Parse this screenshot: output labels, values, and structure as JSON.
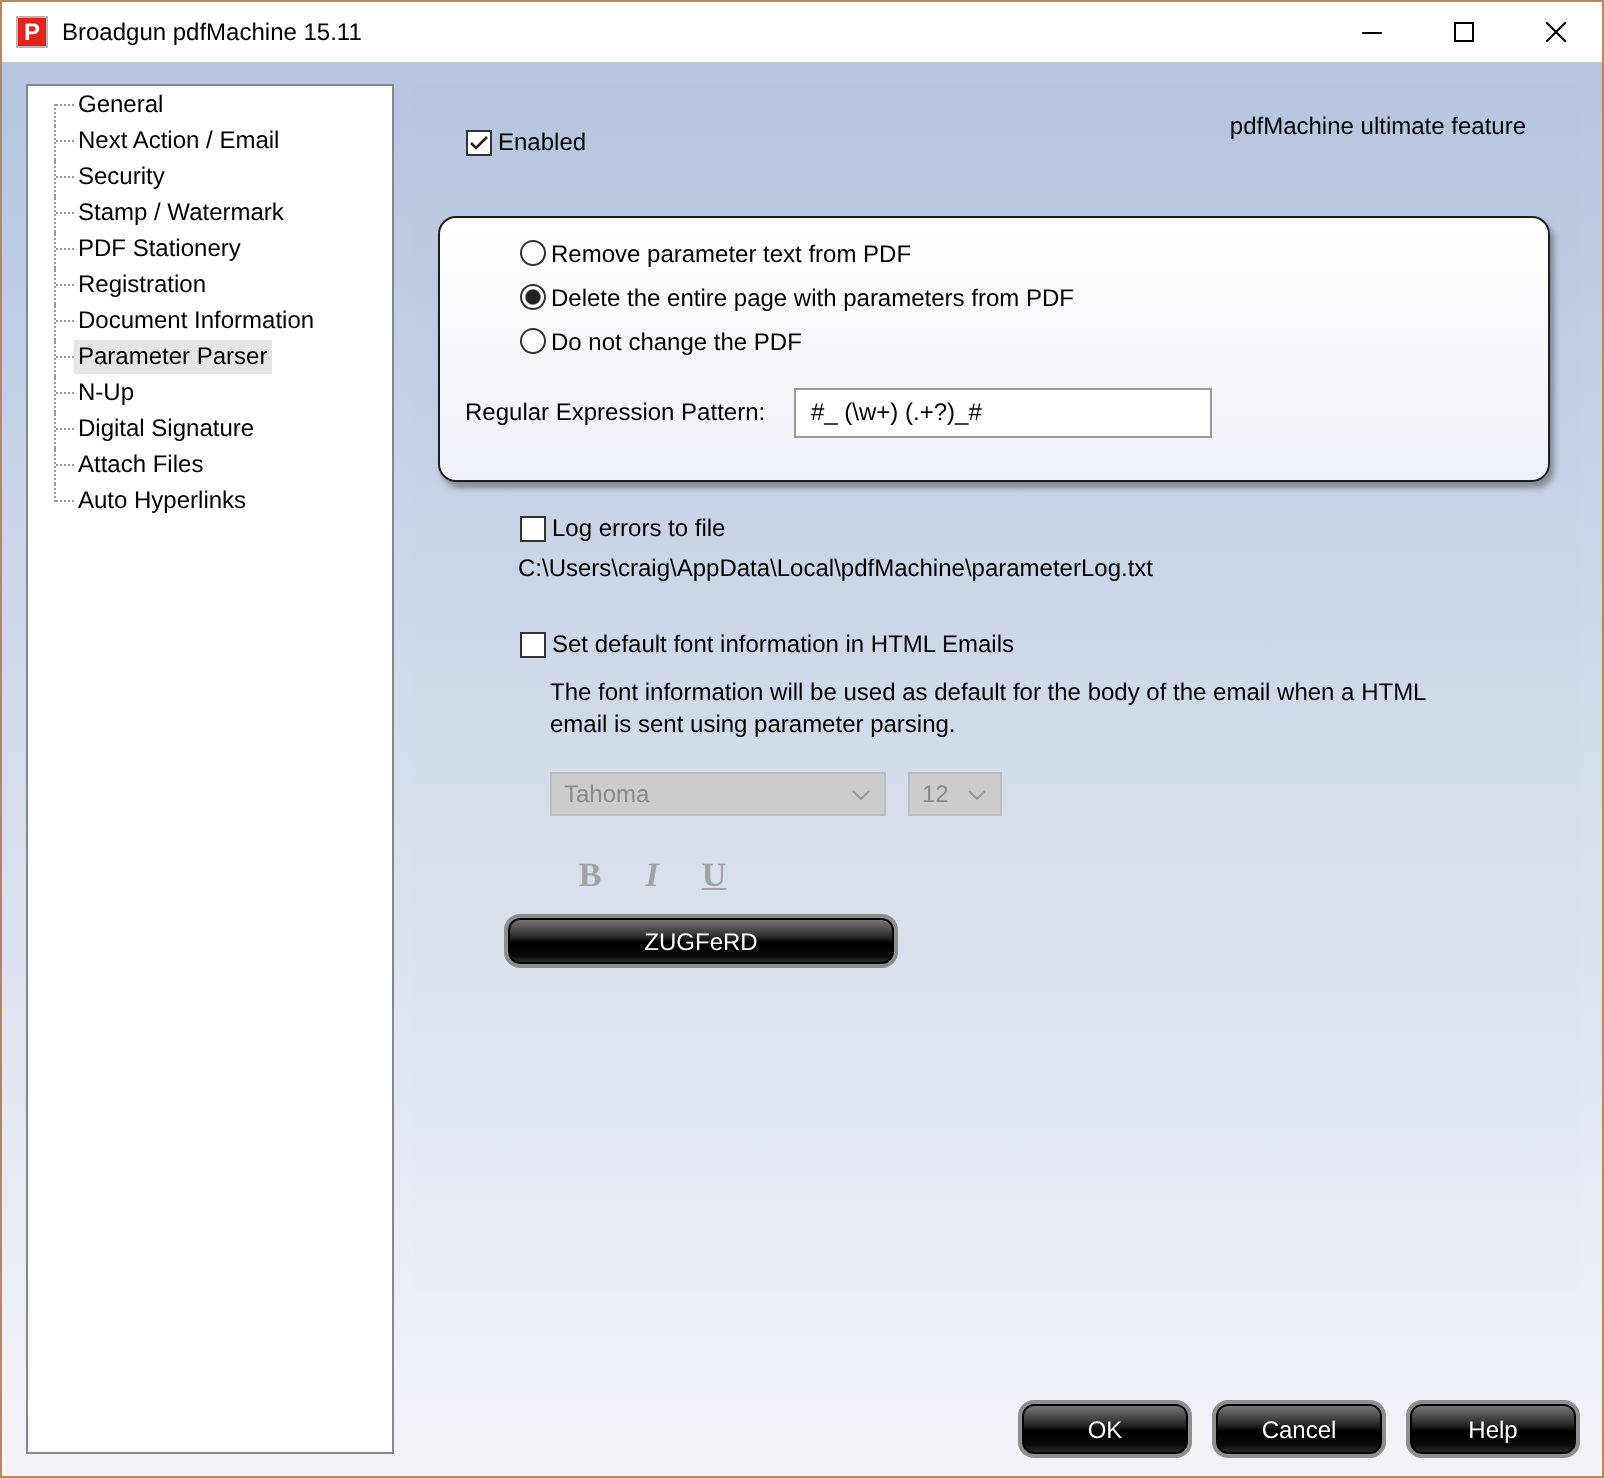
{
  "window": {
    "logo": "P",
    "title": "Broadgun pdfMachine 15.11"
  },
  "sidebar": {
    "items": [
      {
        "label": "General",
        "selected": false
      },
      {
        "label": "Next Action / Email",
        "selected": false
      },
      {
        "label": "Security",
        "selected": false
      },
      {
        "label": "Stamp / Watermark",
        "selected": false
      },
      {
        "label": "PDF Stationery",
        "selected": false
      },
      {
        "label": "Registration",
        "selected": false
      },
      {
        "label": "Document Information",
        "selected": false
      },
      {
        "label": "Parameter Parser",
        "selected": true
      },
      {
        "label": "N-Up",
        "selected": false
      },
      {
        "label": "Digital Signature",
        "selected": false
      },
      {
        "label": "Attach Files",
        "selected": false
      },
      {
        "label": "Auto Hyperlinks",
        "selected": false
      }
    ]
  },
  "panel": {
    "enabled": {
      "label": "Enabled",
      "checked": true
    },
    "feature_note": "pdfMachine ultimate feature",
    "page_action": {
      "options": [
        {
          "label": "Remove parameter text from PDF",
          "selected": false
        },
        {
          "label": "Delete the entire page with parameters from PDF",
          "selected": true
        },
        {
          "label": "Do not change the PDF",
          "selected": false
        }
      ],
      "pattern": {
        "label": "Regular Expression Pattern:",
        "value": "#_ (\\w+) (.+?)_#"
      }
    },
    "log_errors": {
      "label": "Log errors to file",
      "checked": false
    },
    "log_path": "C:\\Users\\craig\\AppData\\Local\\pdfMachine\\parameterLog.txt",
    "html_font": {
      "label": "Set default font information in HTML Emails",
      "checked": false
    },
    "html_font_note": "The font information will be used as default for the body of the email when a HTML email is sent using parameter parsing.",
    "font_select": {
      "value": "Tahoma",
      "disabled": true
    },
    "size_select": {
      "value": "12",
      "disabled": true
    },
    "style_buttons": [
      {
        "kind": "bold",
        "label": "B",
        "disabled": true
      },
      {
        "kind": "italic",
        "label": "I",
        "disabled": true
      },
      {
        "kind": "underline",
        "label": "U",
        "disabled": true
      }
    ],
    "zugferd_button": "ZUGFeRD"
  },
  "buttons": [
    "OK",
    "Cancel",
    "Help"
  ]
}
